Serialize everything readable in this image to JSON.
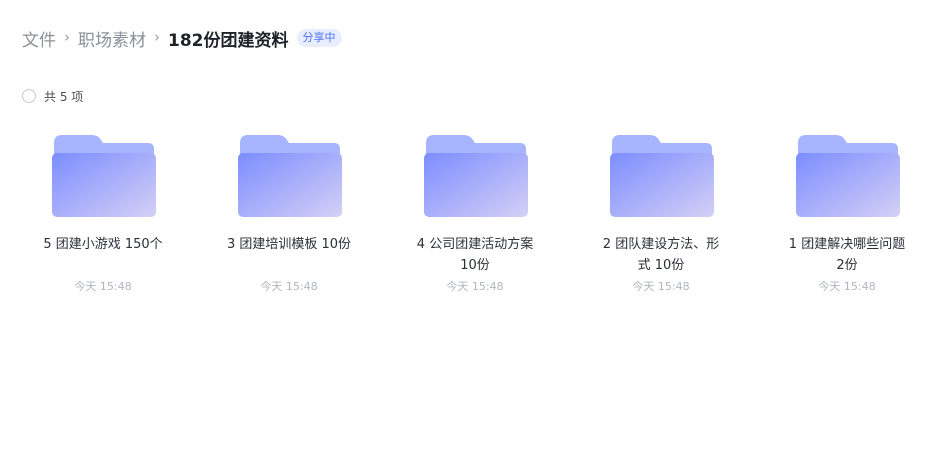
{
  "breadcrumb": {
    "items": [
      "文件",
      "职场素材"
    ],
    "current": "182份团建资料",
    "separator": "›",
    "share_badge": "分享中"
  },
  "summary": {
    "count_label": "共 5 项"
  },
  "folder_colors": {
    "tab": "#a7b4ff",
    "body_start": "#7c8dff",
    "body_end": "#d4d0f6"
  },
  "files": [
    {
      "icon": "folder-icon",
      "name": "5 团建小游戏 150个",
      "time": "今天 15:48"
    },
    {
      "icon": "folder-icon",
      "name": "3 团建培训模板 10份",
      "time": "今天 15:48"
    },
    {
      "icon": "folder-icon",
      "name": "4 公司团建活动方案 10份",
      "time": "今天 15:48"
    },
    {
      "icon": "folder-icon",
      "name": "2 团队建设方法、形式 10份",
      "time": "今天 15:48"
    },
    {
      "icon": "folder-icon",
      "name": "1 团建解决哪些问题 2份",
      "time": "今天 15:48"
    }
  ]
}
